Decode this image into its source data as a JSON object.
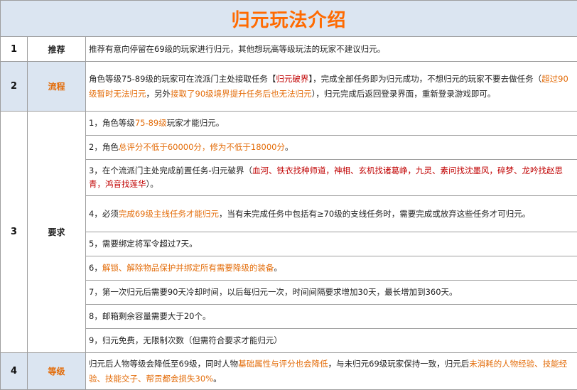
{
  "title": "归元玩法介绍",
  "rows": {
    "recommend": {
      "num": "1",
      "label": "推荐",
      "text": "推荐有意向停留在69级的玩家进行归元，其他想玩高等级玩法的玩家不建议归元。"
    },
    "process": {
      "num": "2",
      "label": "流程",
      "segments": [
        "角色等级75-89级的玩家可在流派门主处接取任务【",
        "归元破界",
        "】，完成全部任务即为归元成功，不想归元的玩家不要去做任务（",
        "超过90级暂时无法归元",
        "，另外",
        "接取了90级境界提升任务后也无法归元",
        "），归元完成后返回登录界面，重新登录游戏即可。"
      ]
    },
    "requirements": {
      "num": "3",
      "label": "要求",
      "items": [
        [
          "1，角色等级",
          "75-89级",
          "玩家才能归元。"
        ],
        [
          "2，角色",
          "总评分不低于60000分，修为不低于18000分",
          "。"
        ],
        [
          "3，在个流派门主处完成前置任务-归元破界（",
          "血河、铁衣找种师道，神相、玄机找诸葛峥，九灵、素问找沈墨风，碎梦、龙吟找赵思青，鸿音找莲华",
          "）。"
        ],
        [
          "4，必须",
          "完成69级主线任务才能归元",
          "，当有未完成任务中包括有≥70级的支线任务时，需要完成或放弃这些任务才可归元。"
        ],
        [
          "5，需要绑定将军令超过7天。",
          "",
          ""
        ],
        [
          "6，",
          "解锁、解除物品保护并绑定所有需要降级的装备",
          "。"
        ],
        [
          "7，第一次归元后需要90天冷却时间，以后每归元一次，时间间隔要求增加30天，最长增加到360天。",
          "",
          ""
        ],
        [
          "8，邮箱剩余容量需要大于20个。",
          "",
          ""
        ],
        [
          "9，归元免费，无限制次数（但需符合要求才能归元）",
          "",
          ""
        ]
      ]
    },
    "level": {
      "num": "4",
      "label": "等级",
      "segments": [
        "归元后人物等级会降低至69级，同时人物",
        "基础属性与评分也会降低",
        "，与未归元69级玩家保持一致，归元后",
        "未消耗的人物经验、技能经验、技能交子、帮贡都会损失30%",
        "。"
      ]
    }
  },
  "colors": {
    "header_bg": "#dbe5f1",
    "title": "#ff6a00",
    "highlight_orange": "#e36c09",
    "highlight_red": "#c00000",
    "border": "#9e9e9e"
  }
}
